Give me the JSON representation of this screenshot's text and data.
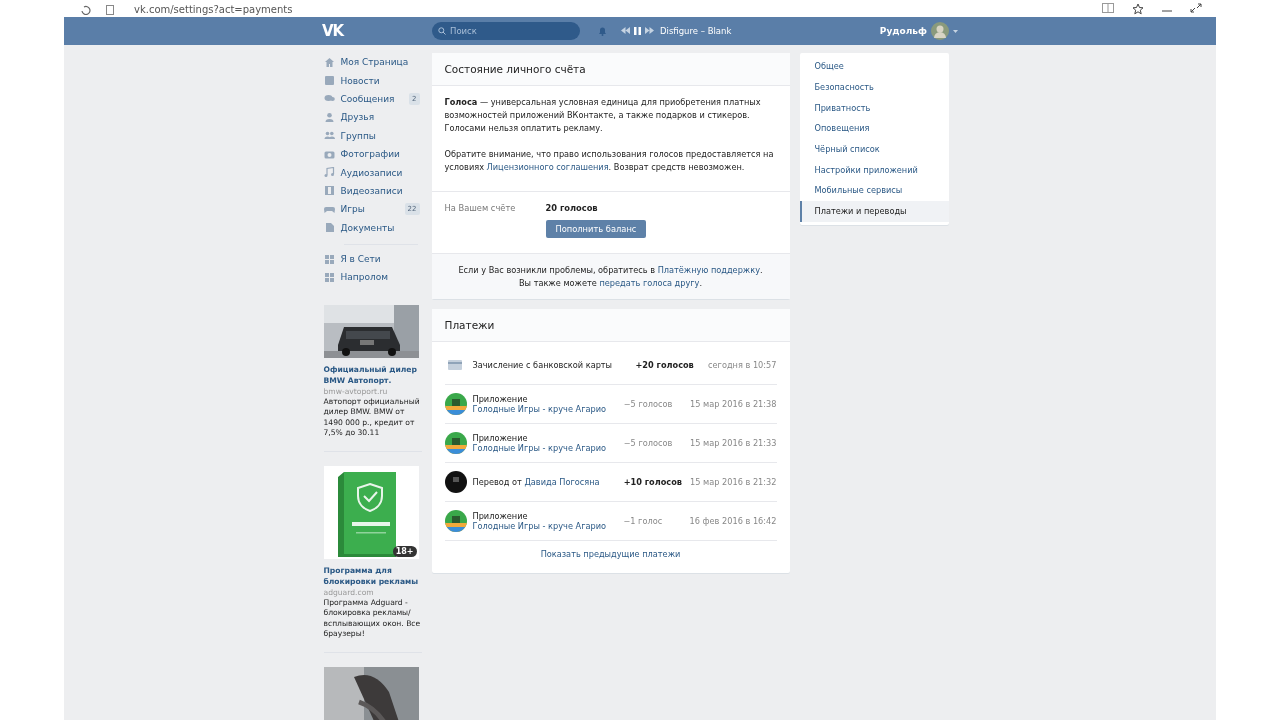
{
  "browser": {
    "url": "vk.com/settings?act=payments"
  },
  "header": {
    "logo": "VK",
    "search": {
      "placeholder": "Поиск"
    },
    "player": {
      "track": "Disfigure – Blank"
    },
    "user": {
      "name": "Рудольф"
    }
  },
  "nav": {
    "items": [
      {
        "label": "Моя Страница"
      },
      {
        "label": "Новости"
      },
      {
        "label": "Сообщения",
        "count": "2"
      },
      {
        "label": "Друзья"
      },
      {
        "label": "Группы"
      },
      {
        "label": "Фотографии"
      },
      {
        "label": "Аудиозаписи"
      },
      {
        "label": "Видеозаписи"
      },
      {
        "label": "Игры",
        "count": "22"
      },
      {
        "label": "Документы"
      }
    ],
    "apps": [
      {
        "label": "Я в Сети"
      },
      {
        "label": "Напролом"
      }
    ]
  },
  "ads": [
    {
      "kind": "car",
      "title": "Официальный дилер BMW Автопорт.",
      "domain": "bmw-avtoport.ru",
      "text": "Автопорт официальный дилер BMW. BMW от 1490 000 р., кредит от 7,5% до 30.11"
    },
    {
      "kind": "box",
      "badge": "18+",
      "title": "Программа для блокировки рекламы",
      "domain": "adguard.com",
      "text": "Программа Adguard - блокировка рекламы/всплывающих окон. Все браузеры!"
    },
    {
      "kind": "knife"
    }
  ],
  "account": {
    "title": "Состояние личного счёта",
    "paragraphs": [
      [
        {
          "text": "**Голоса** — универсальная условная единица для приобретения платных возможностей приложений ВКонтакте, а также подарков и стикеров. Голосами нельзя оплатить рекламу."
        }
      ],
      [
        {
          "text": "Обратите внимание, что право использования голосов предоставляется на условиях "
        },
        {
          "text": "Лицензионного соглашения",
          "link": true
        },
        {
          "text": ". Возврат средств невозможен."
        }
      ]
    ],
    "balance_label": "На Вашем счёте",
    "balance": "20 голосов",
    "button": "Пополнить баланс",
    "help": [
      [
        {
          "text": "Если у Вас возникли проблемы, обратитесь в "
        },
        {
          "text": "Платёжную поддержку",
          "link": true
        },
        {
          "text": "."
        }
      ],
      [
        {
          "text": "Вы также можете "
        },
        {
          "text": "передать голоса другу",
          "link": true
        },
        {
          "text": "."
        }
      ]
    ]
  },
  "payments": {
    "title": "Платежи",
    "rows": [
      {
        "kind": "card",
        "parts": [
          {
            "text": "Зачисление с банковской карты"
          }
        ],
        "amount": "+20 голосов",
        "positive": true,
        "date": "сегодня в 10:57"
      },
      {
        "kind": "app",
        "parts": [
          {
            "text": "Приложение "
          },
          {
            "text": "Голодные Игры - круче Агарио",
            "link": true
          }
        ],
        "amount": "−5 голосов",
        "positive": false,
        "date": "15 мар 2016 в 21:38"
      },
      {
        "kind": "app",
        "parts": [
          {
            "text": "Приложение "
          },
          {
            "text": "Голодные Игры - круче Агарио",
            "link": true
          }
        ],
        "amount": "−5 голосов",
        "positive": false,
        "date": "15 мар 2016 в 21:33"
      },
      {
        "kind": "user",
        "parts": [
          {
            "text": "Перевод от "
          },
          {
            "text": "Давида Погосяна",
            "link": true
          }
        ],
        "amount": "+10 голосов",
        "positive": true,
        "date": "15 мар 2016 в 21:32"
      },
      {
        "kind": "app",
        "parts": [
          {
            "text": "Приложение "
          },
          {
            "text": "Голодные Игры - круче Агарио",
            "link": true
          }
        ],
        "amount": "−1 голос",
        "positive": false,
        "date": "16 фев 2016 в 16:42"
      }
    ],
    "more": "Показать предыдущие платежи"
  },
  "settings_menu": [
    {
      "label": "Общее",
      "selected": false
    },
    {
      "label": "Безопасность",
      "selected": false
    },
    {
      "label": "Приватность",
      "selected": false
    },
    {
      "label": "Оповещения",
      "selected": false
    },
    {
      "label": "Чёрный список",
      "selected": false
    },
    {
      "label": "Настройки приложений",
      "selected": false
    },
    {
      "label": "Мобильные сервисы",
      "selected": false
    },
    {
      "label": "Платежи и переводы",
      "selected": true
    }
  ]
}
